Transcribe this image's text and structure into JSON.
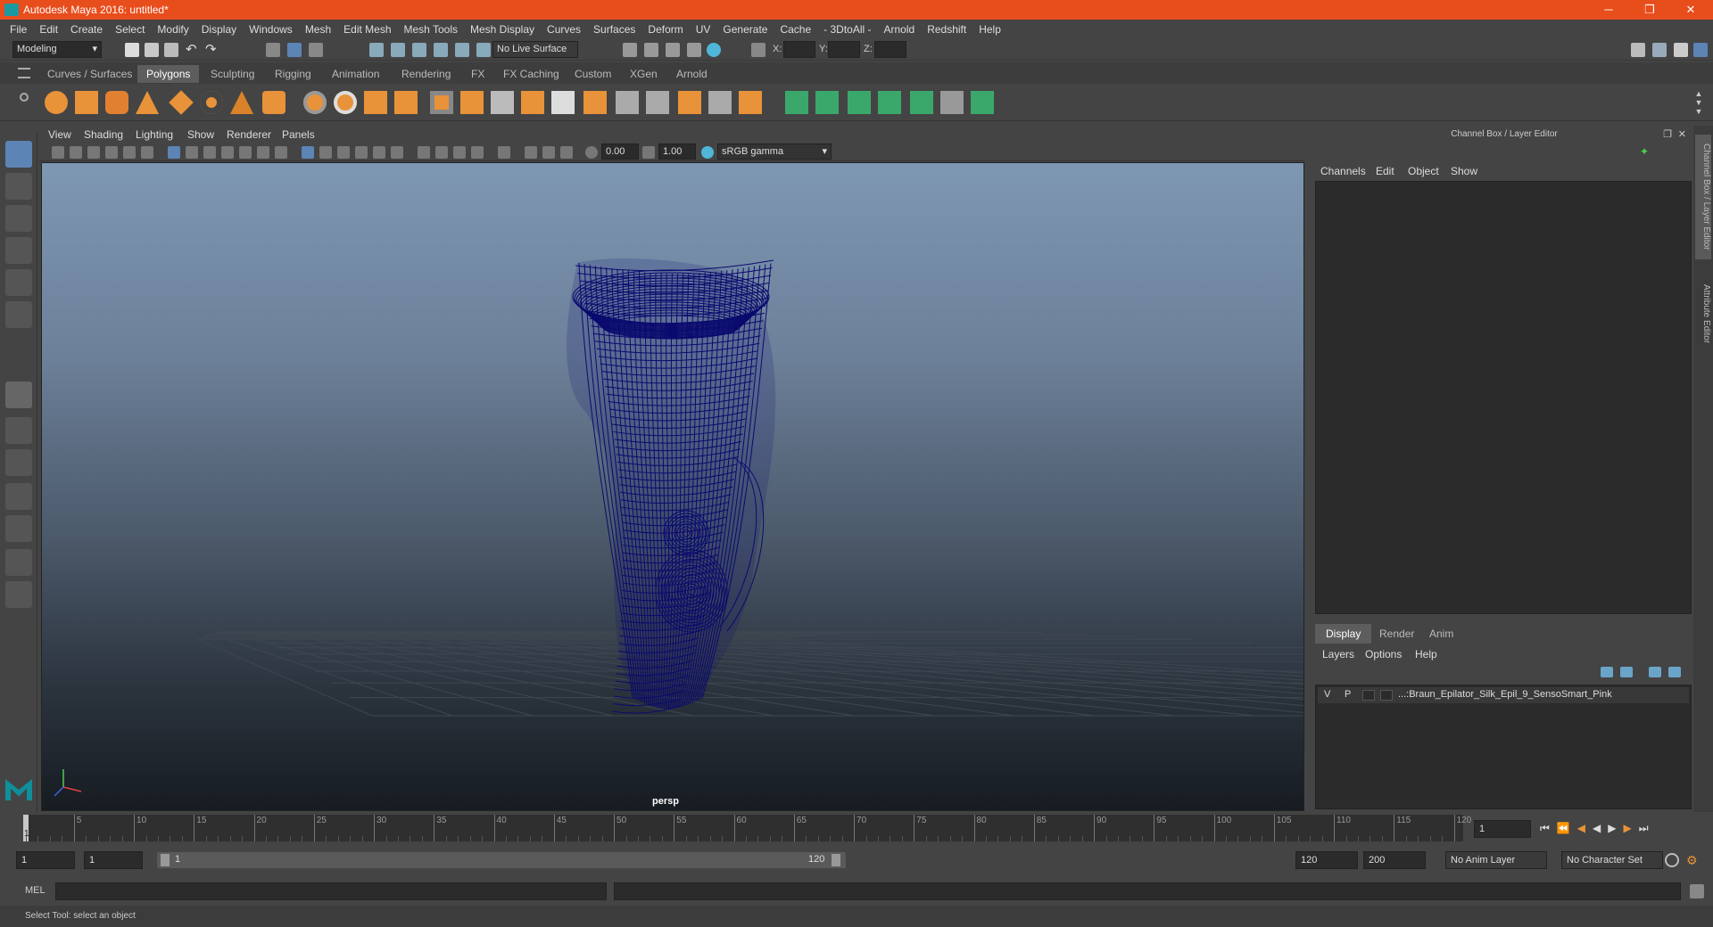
{
  "window": {
    "title": "Autodesk Maya 2016: untitled*",
    "controls": [
      "─",
      "❐",
      "✕"
    ]
  },
  "menu": [
    "File",
    "Edit",
    "Create",
    "Select",
    "Modify",
    "Display",
    "Windows",
    "Mesh",
    "Edit Mesh",
    "Mesh Tools",
    "Mesh Display",
    "Curves",
    "Surfaces",
    "Deform",
    "UV",
    "Generate",
    "Cache",
    "- 3DtoAll -",
    "Arnold",
    "Redshift",
    "Help"
  ],
  "status": {
    "mode": "Modeling",
    "live_surface": "No Live Surface",
    "x_label": "X:",
    "y_label": "Y:",
    "z_label": "Z:"
  },
  "shelf_tabs": [
    "Curves / Surfaces",
    "Polygons",
    "Sculpting",
    "Rigging",
    "Animation",
    "Rendering",
    "FX",
    "FX Caching",
    "Custom",
    "XGen",
    "Arnold"
  ],
  "shelf_active": "Polygons",
  "viewport": {
    "menu": [
      "View",
      "Shading",
      "Lighting",
      "Show",
      "Renderer",
      "Panels"
    ],
    "exposure": "0.00",
    "gamma": "1.00",
    "color_space": "sRGB gamma",
    "camera_label": "persp",
    "wire_color": "#0a0a6e"
  },
  "channel_box": {
    "header": "Channel Box / Layer Editor",
    "menu": [
      "Channels",
      "Edit",
      "Object",
      "Show"
    ]
  },
  "layer_editor": {
    "tabs": [
      "Display",
      "Render",
      "Anim"
    ],
    "active_tab": "Display",
    "menu": [
      "Layers",
      "Options",
      "Help"
    ],
    "layer": {
      "v": "V",
      "p": "P",
      "name": "...:Braun_Epilator_Silk_Epil_9_SensoSmart_Pink"
    }
  },
  "side_tabs": [
    "Channel Box / Layer Editor",
    "Attribute Editor"
  ],
  "timeline": {
    "ticks": [
      "5",
      "10",
      "15",
      "20",
      "25",
      "30",
      "35",
      "40",
      "45",
      "50",
      "55",
      "60",
      "65",
      "70",
      "75",
      "80",
      "85",
      "90",
      "95",
      "100",
      "105",
      "110",
      "115",
      "120"
    ],
    "current_frame": "1",
    "start_marker": "1"
  },
  "range": {
    "start": "1",
    "playback_start": "1",
    "slider_start": "1",
    "slider_end": "120",
    "playback_end": "120",
    "end": "200",
    "anim_layer": "No Anim Layer",
    "char_set": "No Character Set"
  },
  "command": {
    "label": "MEL"
  },
  "help_line": "Select Tool: select an object"
}
